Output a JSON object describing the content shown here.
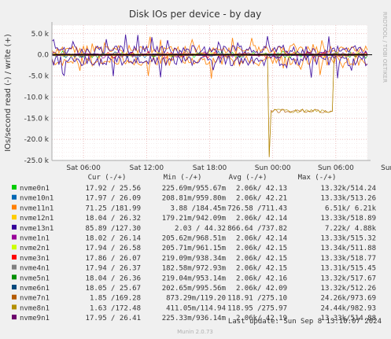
{
  "chart_data": {
    "type": "line",
    "title": "Disk IOs per device - by day",
    "ylabel": "IOs/second read (-) / write (+)",
    "side_label": "RRDTOOL / TOBI OETIKER",
    "ylim": [
      -25000,
      7000
    ],
    "y_ticks": [
      {
        "value": 5000,
        "label": "5.0 k"
      },
      {
        "value": 0,
        "label": "0.0"
      },
      {
        "value": -5000,
        "label": "-5.0 k"
      },
      {
        "value": -10000,
        "label": "-10.0 k"
      },
      {
        "value": -15000,
        "label": "-15.0 k"
      },
      {
        "value": -20000,
        "label": "-20.0 k"
      },
      {
        "value": -25000,
        "label": "-25.0 k"
      }
    ],
    "xlim_hours": [
      0,
      30
    ],
    "x_ticks": [
      {
        "hour": 3,
        "label": "Sat 06:00"
      },
      {
        "hour": 9,
        "label": "Sat 12:00"
      },
      {
        "hour": 15,
        "label": "Sat 18:00"
      },
      {
        "hour": 21,
        "label": "Sun 00:00"
      },
      {
        "hour": 27,
        "label": "Sun 06:00"
      },
      {
        "hour": 33,
        "label": "Sun 12:00"
      }
    ],
    "grid": true,
    "legend_headers": [
      "Cur (-/+)",
      "Min (-/+)",
      "Avg (-/+)",
      "Max (-/+)"
    ],
    "series": [
      {
        "name": "nvme0n1",
        "color": "#00cc00",
        "cur": "17.92 / 25.56",
        "min": "225.69m/955.67m",
        "avg": "2.06k/ 42.13",
        "max": "13.32k/514.24"
      },
      {
        "name": "nvme10n1",
        "color": "#0066b3",
        "cur": "17.97 / 26.09",
        "min": "208.81m/959.80m",
        "avg": "2.06k/ 42.21",
        "max": "13.33k/513.26"
      },
      {
        "name": "nvme11n1",
        "color": "#ff8000",
        "cur": "71.25 /181.99",
        "min": "3.88 /184.45m",
        "avg": "726.58 /711.43",
        "max": "6.51k/ 6.21k"
      },
      {
        "name": "nvme12n1",
        "color": "#ffcc00",
        "cur": "18.04 / 26.32",
        "min": "179.21m/942.09m",
        "avg": "2.06k/ 42.14",
        "max": "13.33k/518.89"
      },
      {
        "name": "nvme13n1",
        "color": "#330099",
        "cur": "85.89 /127.30",
        "min": "2.03 / 44.32",
        "avg": "866.64 /737.82",
        "max": "7.22k/ 4.88k"
      },
      {
        "name": "nvme1n1",
        "color": "#990099",
        "cur": "18.02 / 26.14",
        "min": "205.62m/968.51m",
        "avg": "2.06k/ 42.14",
        "max": "13.33k/515.32"
      },
      {
        "name": "nvme2n1",
        "color": "#ccff00",
        "cur": "17.94 / 26.58",
        "min": "205.71m/961.15m",
        "avg": "2.06k/ 42.15",
        "max": "13.34k/511.88"
      },
      {
        "name": "nvme3n1",
        "color": "#ff0000",
        "cur": "17.86 / 26.07",
        "min": "219.09m/938.34m",
        "avg": "2.06k/ 42.15",
        "max": "13.33k/518.77"
      },
      {
        "name": "nvme4n1",
        "color": "#808080",
        "cur": "17.94 / 26.37",
        "min": "182.58m/972.93m",
        "avg": "2.06k/ 42.15",
        "max": "13.31k/515.45"
      },
      {
        "name": "nvme5n1",
        "color": "#008f00",
        "cur": "18.04 / 26.36",
        "min": "219.04m/953.14m",
        "avg": "2.06k/ 42.16",
        "max": "13.32k/517.67"
      },
      {
        "name": "nvme6n1",
        "color": "#00487d",
        "cur": "18.05 / 25.67",
        "min": "202.65m/995.56m",
        "avg": "2.06k/ 42.09",
        "max": "13.32k/512.26"
      },
      {
        "name": "nvme7n1",
        "color": "#b35a00",
        "cur": "1.85 /169.28",
        "min": "873.29m/119.20",
        "avg": "118.91 /275.10",
        "max": "24.26k/973.69"
      },
      {
        "name": "nvme8n1",
        "color": "#b38f00",
        "cur": "1.63 /172.48",
        "min": "411.05m/114.94",
        "avg": "118.95 /275.97",
        "max": "24.44k/982.93"
      },
      {
        "name": "nvme9n1",
        "color": "#6b006b",
        "cur": "17.95 / 26.41",
        "min": "225.33m/936.14m",
        "avg": "2.06k/ 42.19",
        "max": "13.33k/514.88"
      }
    ],
    "last_update": "Last update: Sun Sep  8 13:10:07 2024",
    "footer": "Munin 2.0.73"
  }
}
